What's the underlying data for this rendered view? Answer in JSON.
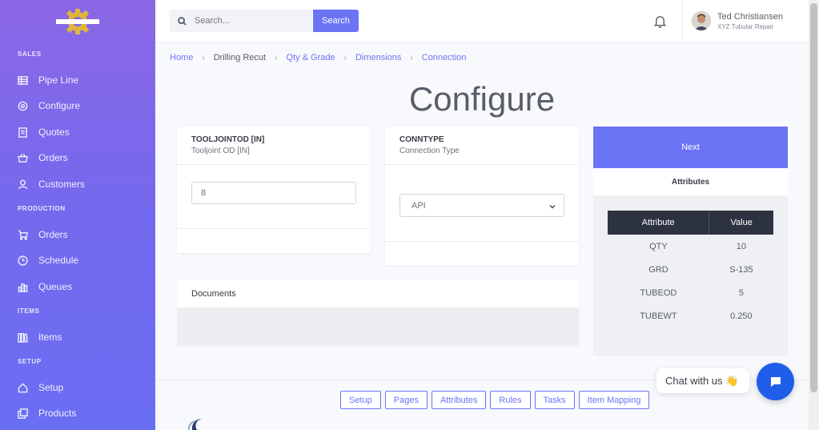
{
  "sidebar": {
    "sections": {
      "sales": "SALES",
      "production": "PRODUCTION",
      "items": "ITEMS",
      "setup": "SETUP"
    },
    "items": [
      {
        "label": "Pipe Line",
        "icon": "table-icon"
      },
      {
        "label": "Configure",
        "icon": "gear-icon"
      },
      {
        "label": "Quotes",
        "icon": "document-icon"
      },
      {
        "label": "Orders",
        "icon": "basket-icon"
      },
      {
        "label": "Customers",
        "icon": "user-icon"
      },
      {
        "label": "Orders",
        "icon": "cart-icon"
      },
      {
        "label": "Schedule",
        "icon": "clock-icon"
      },
      {
        "label": "Queues",
        "icon": "bar-chart-icon"
      },
      {
        "label": "Items",
        "icon": "library-icon"
      },
      {
        "label": "Setup",
        "icon": "home-icon"
      },
      {
        "label": "Products",
        "icon": "copy-icon"
      }
    ]
  },
  "topbar": {
    "search_placeholder": "Search...",
    "search_button": "Search",
    "user_name": "Ted Christiansen",
    "user_company": "XYZ Tubular Repair"
  },
  "breadcrumb": [
    "Home",
    "Drilling Recut",
    "Qty & Grade",
    "Dimensions",
    "Connection"
  ],
  "page_title": "Configure",
  "tooljoint": {
    "title": "TOOLJOINTOD [IN]",
    "subtitle": "Tooljoint OD [IN]",
    "value": "8"
  },
  "conntype": {
    "title": "CONNTYPE",
    "subtitle": "Connection Type",
    "selected": "API"
  },
  "next_button": "Next",
  "attributes": {
    "heading": "Attributes",
    "col_attribute": "Attribute",
    "col_value": "Value",
    "rows": [
      {
        "attribute": "QTY",
        "value": "10"
      },
      {
        "attribute": "GRD",
        "value": "S-135"
      },
      {
        "attribute": "TUBEOD",
        "value": "5"
      },
      {
        "attribute": "TUBEWT",
        "value": "0.250"
      }
    ]
  },
  "documents": {
    "heading": "Documents"
  },
  "footer_buttons": [
    "Setup",
    "Pages",
    "Attributes",
    "Rules",
    "Tasks",
    "Item Mapping"
  ],
  "chat": {
    "label": "Chat with us 👋"
  },
  "colors": {
    "accent": "#6c74f6",
    "sidebar_top": "#8b67e6",
    "sidebar_bottom": "#6a6ef3",
    "chat": "#1f5ee8",
    "table_head": "#2d3240"
  }
}
